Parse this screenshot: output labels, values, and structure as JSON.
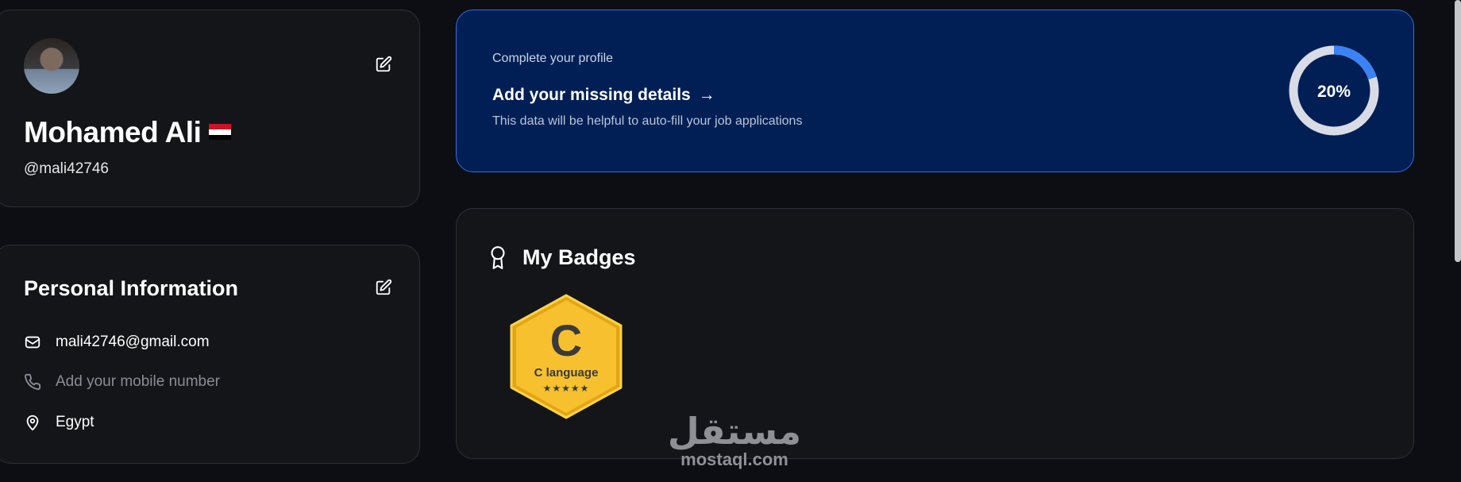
{
  "profile": {
    "name": "Mohamed Ali",
    "username": "@mali42746",
    "flag_colors": [
      "#ce1126",
      "#ffffff",
      "#000000"
    ]
  },
  "personal_info": {
    "title": "Personal Information",
    "email": "mali42746@gmail.com",
    "mobile_placeholder": "Add your mobile number",
    "location": "Egypt"
  },
  "complete_profile": {
    "small": "Complete your profile",
    "title": "Add your missing details",
    "arrow": "→",
    "description": "This data will be helpful to auto-fill your job applications",
    "progress_label": "20%",
    "progress": 0.2,
    "accent": "#3b82f6"
  },
  "badges": {
    "title": "My Badges",
    "items": [
      {
        "letter": "C",
        "label": "C language",
        "stars": "★★★★★",
        "color": "#f6be2c"
      }
    ]
  },
  "watermark": {
    "arabic": "مستقل",
    "latin": "mostaql.com"
  }
}
